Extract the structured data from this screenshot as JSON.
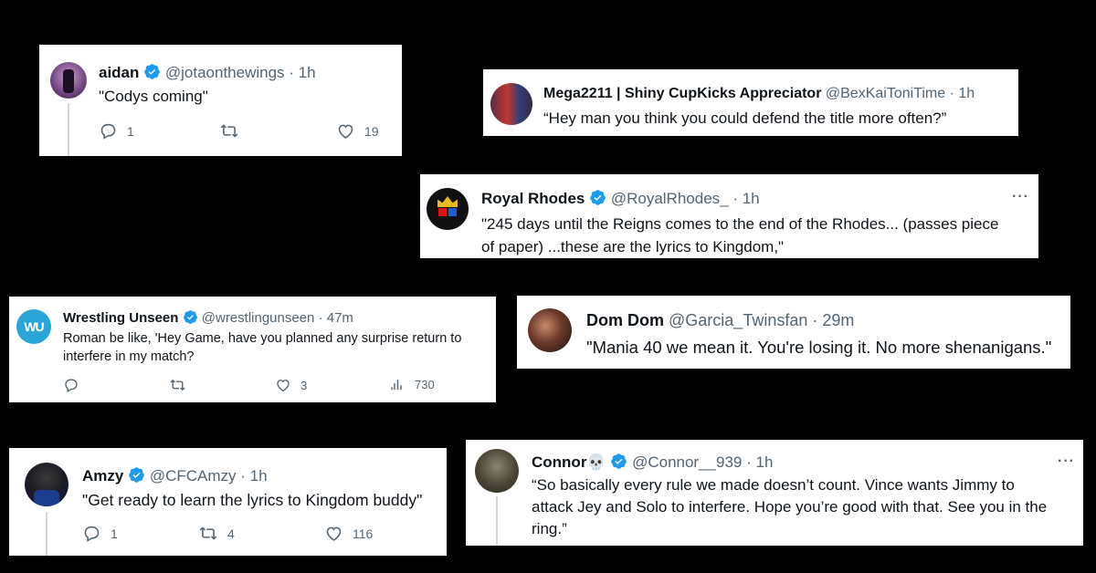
{
  "tweets": [
    {
      "name": "aidan",
      "handle": "@jotaonthewings",
      "time": "· 1h",
      "text": "\"Codys coming\"",
      "replies": "1",
      "retweets": "",
      "likes": "19"
    },
    {
      "name": "Mega2211 | Shiny CupKicks Appreciator",
      "handle": "@BexKaiToniTime",
      "time": "· 1h",
      "text": "“Hey man you think you could defend the title more often?”"
    },
    {
      "name": "Royal Rhodes",
      "handle": "@RoyalRhodes_",
      "time": "· 1h",
      "more": "···",
      "text_line1": "\"245 days until the Reigns comes to the end of the Rhodes... (passes piece",
      "text_line2": "of paper) ...these are the lyrics to Kingdom,\""
    },
    {
      "name": "Wrestling Unseen",
      "handle": "@wrestlingunseen",
      "time": "· 47m",
      "avatar_text": "WU",
      "text_line1": "Roman be like, 'Hey Game, have you planned any surprise return to",
      "text_line2": "interfere in my match?",
      "replies": "",
      "retweets": "",
      "likes": "3",
      "views": "730"
    },
    {
      "name": "Dom Dom",
      "handle": "@Garcia_Twinsfan",
      "time": "· 29m",
      "text": "\"Mania 40 we mean it. You're losing it. No more shenanigans.\""
    },
    {
      "name": "Amzy",
      "handle": "@CFCAmzy",
      "time": "· 1h",
      "text": "\"Get ready to learn the lyrics to Kingdom buddy\"",
      "replies": "1",
      "retweets": "4",
      "likes": "116"
    },
    {
      "name": "Connor💀",
      "handle": "@Connor__939",
      "time": "· 1h",
      "more": "···",
      "text_line1": "“So basically every rule we made doesn’t count. Vince wants Jimmy to",
      "text_line2": "attack Jey and Solo to interfere. Hope you’re good with that. See you in the",
      "text_line3": "ring.”"
    }
  ],
  "colors": {
    "verified": "#1d9bf0",
    "handle": "#536471",
    "background": "#000000",
    "card": "#ffffff"
  },
  "icons": [
    "verified-badge-icon",
    "reply-icon",
    "retweet-icon",
    "like-icon",
    "views-icon",
    "more-icon"
  ]
}
